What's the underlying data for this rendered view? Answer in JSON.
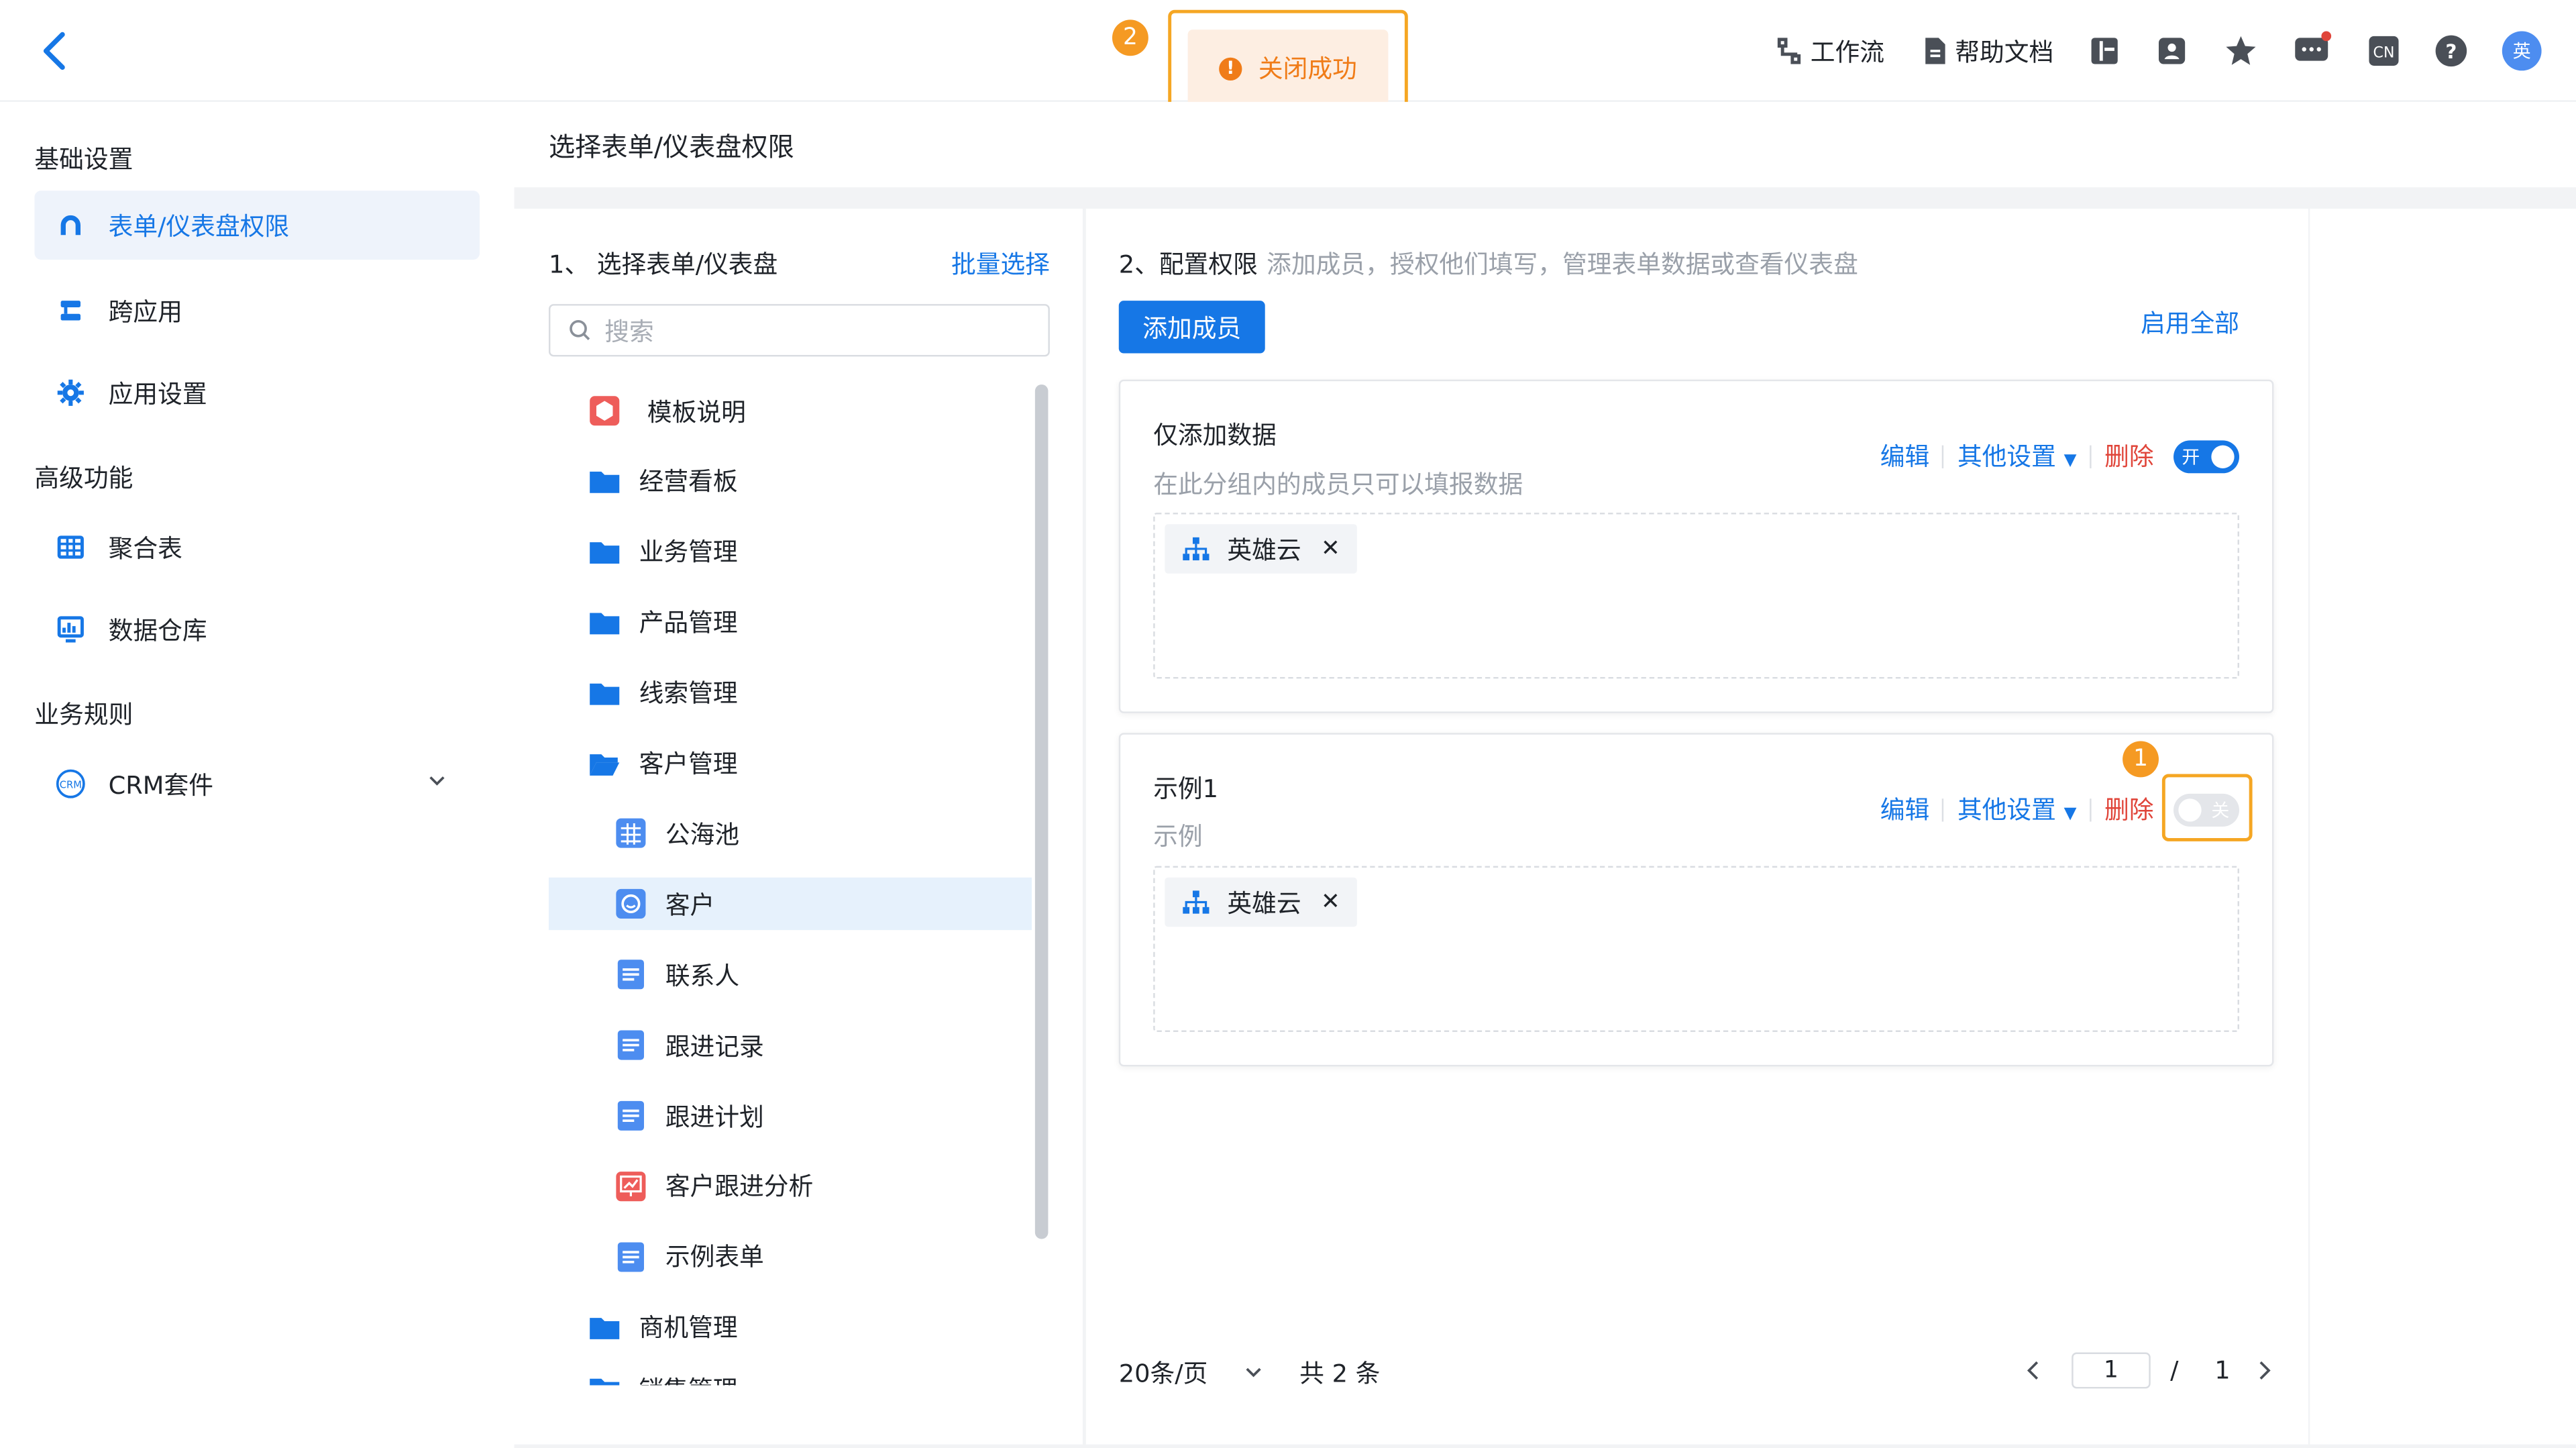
{
  "topbar": {
    "toast_step": "2",
    "toast_text": "关闭成功",
    "workflow_label": "工作流",
    "help_label": "帮助文档",
    "avatar_text": "英",
    "icons": [
      "back-icon",
      "workflow-icon",
      "doc-icon",
      "layout-icon",
      "contacts-icon",
      "star-icon",
      "message-icon",
      "language-icon",
      "help-icon",
      "avatar"
    ]
  },
  "sidebar": {
    "sections": [
      {
        "title": "基础设置",
        "items": [
          {
            "label": "表单/仪表盘权限",
            "icon": "permission-icon",
            "active": true
          },
          {
            "label": "跨应用",
            "icon": "cross-app-icon"
          },
          {
            "label": "应用设置",
            "icon": "gear-icon"
          }
        ]
      },
      {
        "title": "高级功能",
        "items": [
          {
            "label": "聚合表",
            "icon": "table-icon"
          },
          {
            "label": "数据仓库",
            "icon": "monitor-icon"
          }
        ]
      },
      {
        "title": "业务规则",
        "items": [
          {
            "label": "CRM套件",
            "icon": "crm-icon",
            "expandable": true
          }
        ]
      }
    ]
  },
  "page": {
    "title": "选择表单/仪表盘权限"
  },
  "left_panel": {
    "step_title": "1、 选择表单/仪表盘",
    "batch_select": "批量选择",
    "search_placeholder": "搜索",
    "tree": [
      {
        "label": "模板说明",
        "icon": "template-icon"
      },
      {
        "label": "经营看板",
        "icon": "folder-icon"
      },
      {
        "label": "业务管理",
        "icon": "folder-icon"
      },
      {
        "label": "产品管理",
        "icon": "folder-icon"
      },
      {
        "label": "线索管理",
        "icon": "folder-icon"
      },
      {
        "label": "客户管理",
        "icon": "folder-open-icon"
      },
      {
        "label": "公海池",
        "icon": "grid-form-icon"
      },
      {
        "label": "客户",
        "icon": "customer-form-icon",
        "selected": true
      },
      {
        "label": "联系人",
        "icon": "form-icon"
      },
      {
        "label": "跟进记录",
        "icon": "form-icon"
      },
      {
        "label": "跟进计划",
        "icon": "form-icon"
      },
      {
        "label": "客户跟进分析",
        "icon": "dashboard-icon"
      },
      {
        "label": "示例表单",
        "icon": "form-icon"
      },
      {
        "label": "商机管理",
        "icon": "folder-icon"
      },
      {
        "label": "销售管理",
        "icon": "folder-icon"
      }
    ]
  },
  "mid_panel": {
    "step_title": "2、配置权限",
    "step_desc": "添加成员，授权他们填写，管理表单数据或查看仪表盘",
    "add_member": "添加成员",
    "enable_all": "启用全部",
    "groups": [
      {
        "title": "仅添加数据",
        "desc": "在此分组内的成员只可以填报数据",
        "edit": "编辑",
        "other": "其他设置",
        "delete": "删除",
        "toggle_text": "开",
        "enabled": true,
        "member": "英雄云"
      },
      {
        "title": "示例1",
        "desc": "示例",
        "edit": "编辑",
        "other": "其他设置",
        "delete": "删除",
        "toggle_text": "关",
        "enabled": false,
        "member": "英雄云",
        "step": "1"
      }
    ],
    "pagination": {
      "page_size": "20条/页",
      "total": "共 2 条",
      "current": "1",
      "sep": "/",
      "pages": "1"
    }
  },
  "colors": {
    "accent": "#1677e6",
    "danger": "#e0453a",
    "highlight": "#f5a623"
  }
}
